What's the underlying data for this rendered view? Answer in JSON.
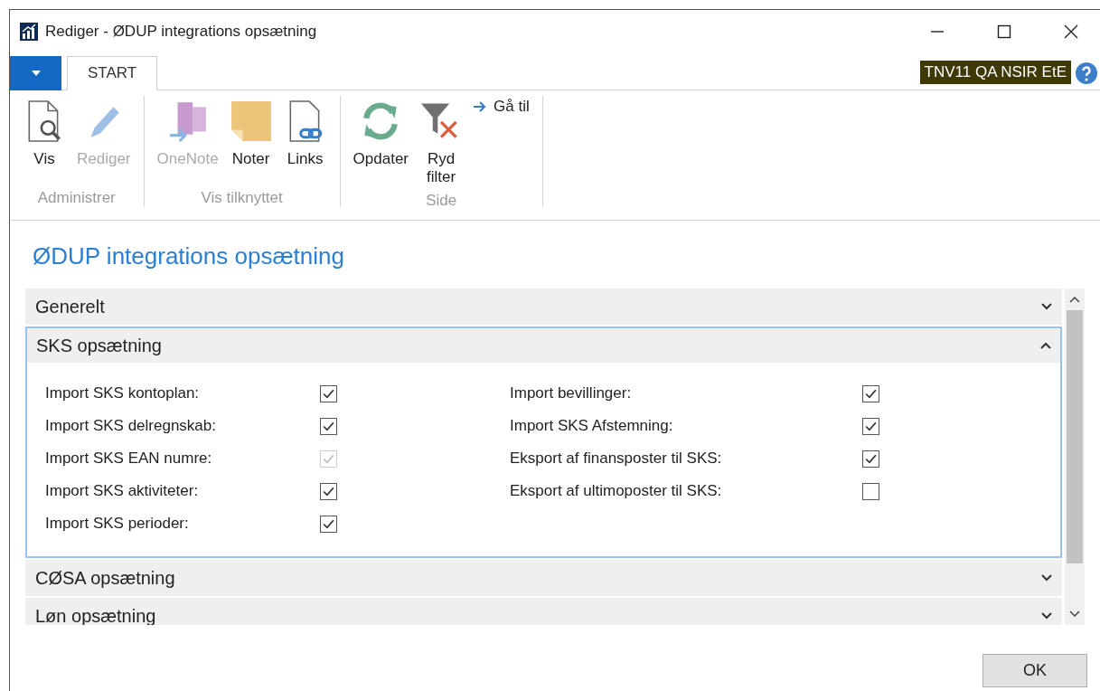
{
  "window": {
    "title": "Rediger - ØDUP integrations opsætning"
  },
  "ribbon_tabs": [
    {
      "label": "START",
      "selected": true
    }
  ],
  "company": "TNV11 QA NSIR EtE",
  "ribbon_groups": [
    {
      "label": "Administrer",
      "buttons": [
        {
          "label": "Vis",
          "kind": "view",
          "disabled": false
        },
        {
          "label": "Rediger",
          "kind": "edit",
          "disabled": true
        }
      ]
    },
    {
      "label": "Vis tilknyttet",
      "buttons": [
        {
          "label": "OneNote",
          "kind": "onenote",
          "disabled": true
        },
        {
          "label": "Noter",
          "kind": "notes",
          "disabled": false
        },
        {
          "label": "Links",
          "kind": "links",
          "disabled": false
        }
      ]
    },
    {
      "label": "Side",
      "buttons": [
        {
          "label": "Opdater",
          "kind": "refresh",
          "disabled": false
        },
        {
          "label": "Ryd filter",
          "kind": "filter",
          "disabled": false
        },
        {
          "label": "Gå til",
          "kind": "goto",
          "disabled": false
        }
      ]
    }
  ],
  "page_title": "ØDUP integrations opsætning",
  "fasttabs": [
    {
      "title": "Generelt",
      "expanded": false,
      "selected": false
    },
    {
      "title": "SKS opsætning",
      "expanded": true,
      "selected": true,
      "columns": [
        [
          {
            "label": "Import SKS kontoplan:",
            "checked": true,
            "disabled": false
          },
          {
            "label": "Import SKS delregnskab:",
            "checked": true,
            "disabled": false
          },
          {
            "label": "Import SKS EAN numre:",
            "checked": true,
            "disabled": true
          },
          {
            "label": "Import SKS aktiviteter:",
            "checked": true,
            "disabled": false
          },
          {
            "label": "Import SKS perioder:",
            "checked": true,
            "disabled": false
          }
        ],
        [
          {
            "label": "Import bevillinger:",
            "checked": true,
            "disabled": false
          },
          {
            "label": "Import SKS Afstemning:",
            "checked": true,
            "disabled": false
          },
          {
            "label": "Eksport af finansposter til SKS:",
            "checked": true,
            "disabled": false
          },
          {
            "label": "Eksport af ultimoposter til SKS:",
            "checked": false,
            "disabled": false
          }
        ]
      ]
    },
    {
      "title": "CØSA opsætning",
      "expanded": false,
      "selected": false
    },
    {
      "title": "Løn opsætning",
      "expanded": false,
      "selected": false
    }
  ],
  "ok_button": "OK"
}
